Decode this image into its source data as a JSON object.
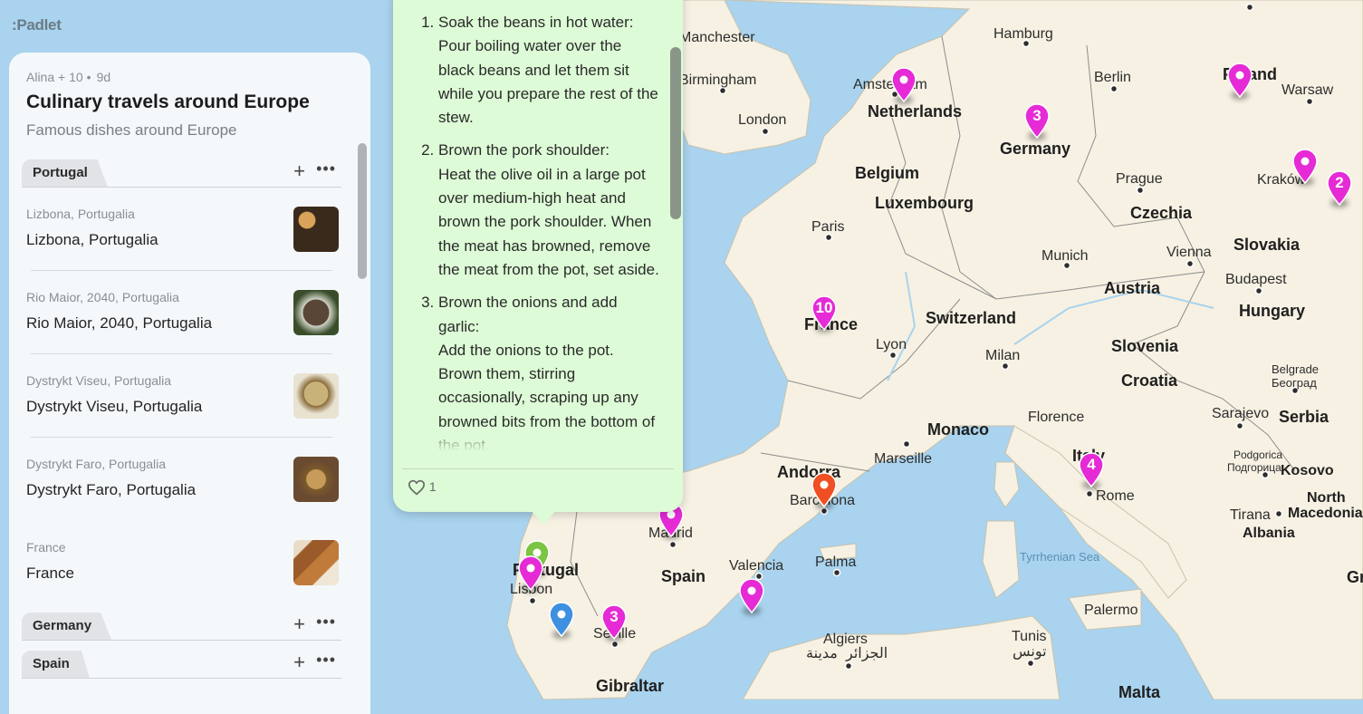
{
  "app": {
    "logo_text": ":Padlet"
  },
  "board": {
    "author_meta": "Alina + 10",
    "age": "9d",
    "title": "Culinary travels around Europe",
    "subtitle": "Famous dishes around Europe"
  },
  "sections": [
    {
      "name": "Portugal"
    },
    {
      "name": "Germany"
    },
    {
      "name": "Spain"
    }
  ],
  "posts": [
    {
      "subtitle": "Lizbona, Portugalia",
      "title": "Lizbona, Portugalia"
    },
    {
      "subtitle": "Rio Maior, 2040, Portugalia",
      "title": "Rio Maior, 2040, Portugalia"
    },
    {
      "subtitle": "Dystrykt Viseu, Portugalia",
      "title": "Dystrykt Viseu, Portugalia"
    },
    {
      "subtitle": "Dystrykt Faro, Portugalia",
      "title": "Dystrykt Faro, Portugalia"
    },
    {
      "subtitle": "France",
      "title": "France"
    }
  ],
  "card": {
    "steps": [
      {
        "heading": "Soak the beans in hot water:",
        "text": "Pour boiling water over the black beans and let them sit while you prepare the rest of the stew."
      },
      {
        "heading": "Brown the pork shoulder:",
        "text": "Heat the olive oil in a large pot over medium-high heat and brown the pork shoulder. When the meat has browned, remove the meat from the pot, set aside."
      },
      {
        "heading": "Brown the onions and add garlic:",
        "text": "Add the onions to the pot. Brown them, stirring occasionally, scraping up any browned bits from the bottom of the pot."
      }
    ],
    "like_count": "1"
  },
  "map": {
    "cities": [
      "Manchester",
      "Birmingham",
      "London",
      "Amsterdam",
      "Hamburg",
      "Berlin",
      "Warsaw",
      "Paris",
      "Prague",
      "Kraków",
      "Munich",
      "Vienna",
      "Budapest",
      "Lyon",
      "Milan",
      "Marseille",
      "Florence",
      "Belgrade",
      "Београд",
      "Sarajevo",
      "Podgorica",
      "Подгорица",
      "Tirana",
      "Rome",
      "Barcelona",
      "Madrid",
      "Valencia",
      "Palma",
      "Lisbon",
      "Seville",
      "Algiers",
      "الجزائر",
      "مدينة",
      "Tunis",
      "تونس",
      "Palermo",
      "Tyrrhenian Sea"
    ],
    "countries": [
      "Netherlands",
      "Germany",
      "Poland",
      "Belgium",
      "Luxembourg",
      "Czechia",
      "Slovakia",
      "France",
      "Switzerland",
      "Austria",
      "Hungary",
      "Slovenia",
      "Croatia",
      "Monaco",
      "Andorra",
      "Italy",
      "Serbia",
      "Kosovo",
      "North",
      "Macedonia",
      "Albania",
      "Spain",
      "Portugal",
      "Gibraltar",
      "Malta",
      "Greece"
    ],
    "pin_colors": {
      "magenta": "#e52ad6",
      "green": "#7cc443",
      "blue": "#3d8fe0",
      "orange": "#ef4f22"
    },
    "pins": [
      {
        "color": "magenta",
        "label": ""
      },
      {
        "color": "magenta",
        "label": "3"
      },
      {
        "color": "magenta",
        "label": ""
      },
      {
        "color": "magenta",
        "label": ""
      },
      {
        "color": "magenta",
        "label": "2"
      },
      {
        "color": "magenta",
        "label": "10"
      },
      {
        "color": "orange",
        "label": ""
      },
      {
        "color": "magenta",
        "label": "4"
      },
      {
        "color": "magenta",
        "label": ""
      },
      {
        "color": "green",
        "label": ""
      },
      {
        "color": "magenta",
        "label": ""
      },
      {
        "color": "blue",
        "label": ""
      },
      {
        "color": "magenta",
        "label": "3"
      },
      {
        "color": "magenta",
        "label": ""
      }
    ]
  }
}
